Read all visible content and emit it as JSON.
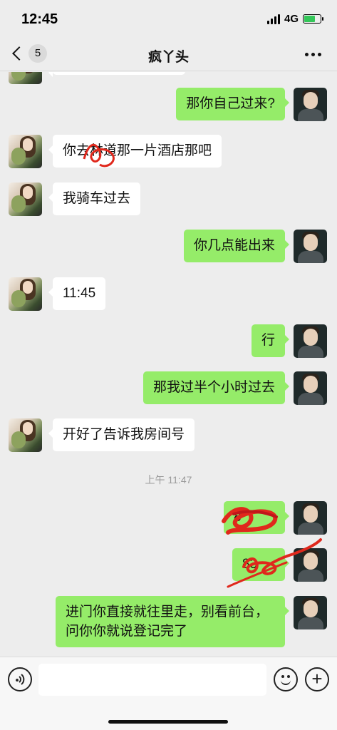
{
  "status_bar": {
    "time": "12:45",
    "network": "4G"
  },
  "nav": {
    "unread_count": "5",
    "title": "疯丫头"
  },
  "messages": [
    {
      "side": "right",
      "text": "那你自己过来?"
    },
    {
      "side": "left",
      "text": "你去林道那一片酒店那吧"
    },
    {
      "side": "left",
      "text": "我骑车过去"
    },
    {
      "side": "right",
      "text": "你几点能出来"
    },
    {
      "side": "left",
      "text": "11:45"
    },
    {
      "side": "right",
      "text": "行"
    },
    {
      "side": "right",
      "text": "那我过半个小时过去"
    },
    {
      "side": "left",
      "text": "开好了告诉我房间号"
    },
    {
      "type": "timestamp",
      "text": "上午 11:47"
    },
    {
      "side": "right",
      "text": "8"
    },
    {
      "side": "right",
      "text": "83"
    },
    {
      "side": "right",
      "text": "进门你直接就往里走，别看前台，问你你就说登记完了"
    }
  ],
  "input": {
    "placeholder": ""
  },
  "colors": {
    "background": "#ededed",
    "bubble_self": "#95ec69",
    "bubble_other": "#ffffff",
    "scribble": "#e0281c"
  }
}
